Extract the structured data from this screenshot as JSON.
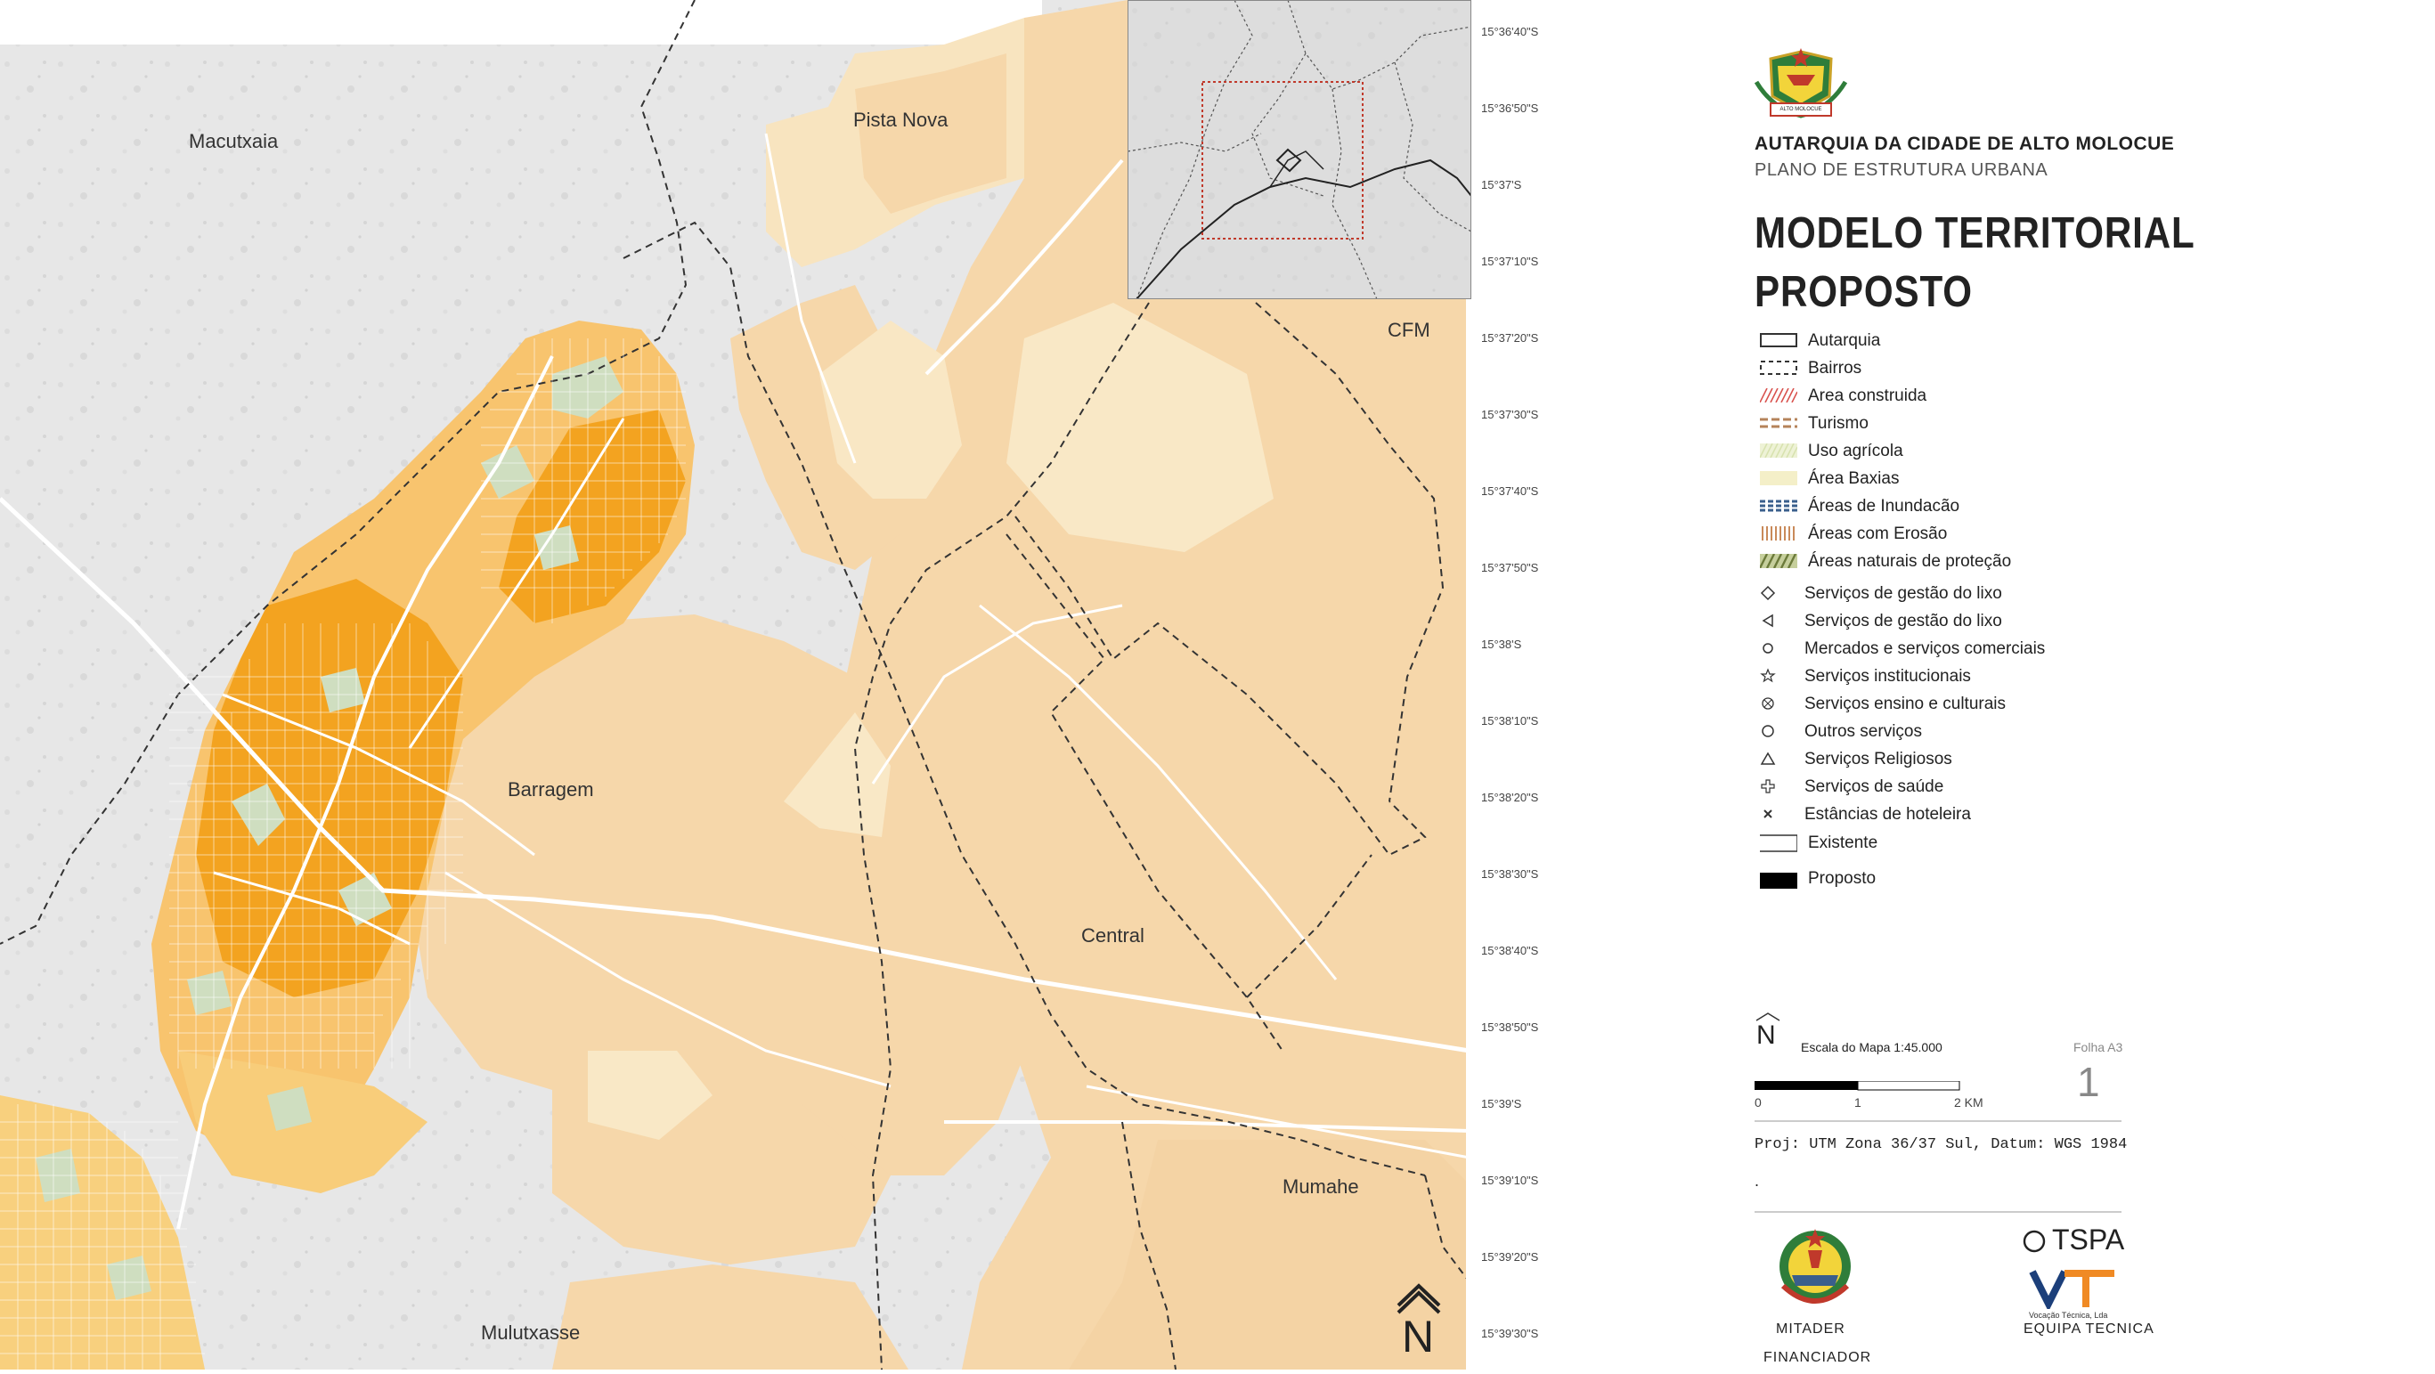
{
  "map": {
    "places": [
      {
        "name": "Macutxaia"
      },
      {
        "name": "Pista Nova"
      },
      {
        "name": "CFM"
      },
      {
        "name": "Barragem"
      },
      {
        "name": "Central"
      },
      {
        "name": "Mumahe"
      },
      {
        "name": "Mulutxasse"
      }
    ],
    "latitude_ticks": [
      "15°36'40\"S",
      "15°36'50\"S",
      "15°37'S",
      "15°37'10\"S",
      "15°37'20\"S",
      "15°37'30\"S",
      "15°37'40\"S",
      "15°37'50\"S",
      "15°38'S",
      "15°38'10\"S",
      "15°38'20\"S",
      "15°38'30\"S",
      "15°38'40\"S",
      "15°38'50\"S",
      "15°39'S",
      "15°39'10\"S",
      "15°39'20\"S",
      "15°39'30\"S"
    ],
    "north_arrow_label": "N",
    "colors": {
      "background_gray": "#e6e6e6",
      "land_orange": "#f7d8ab",
      "light_zone": "#f8e6c2",
      "dense_orange": "#f4a01e",
      "medium_orange": "#f8c46e",
      "green_plot": "#cfdec0",
      "road": "#ffffff",
      "boundary": "#333333"
    }
  },
  "panel": {
    "authority": "AUTARQUIA DA CIDADE DE ALTO MOLOCUE",
    "plan": "PLANO DE ESTRUTURA URBANA",
    "title_line1": "MODELO TERRITORIAL",
    "title_line2": "PROPOSTO",
    "emblem_caption": "ALTO MOLOCUE",
    "legend": [
      {
        "label": "Autarquia",
        "icon": "solid-outline-rect"
      },
      {
        "label": "Bairros",
        "icon": "dashed-outline-rect"
      },
      {
        "label": "Area construida",
        "icon": "red-hatch",
        "color": "#d9534f"
      },
      {
        "label": "Turismo",
        "icon": "brown-dashes",
        "color": "#b5835a"
      },
      {
        "label": "Uso agrícola",
        "icon": "light-green-hatch",
        "color": "#d8e2b0"
      },
      {
        "label": "Área Baxias",
        "icon": "pale-yellow-fill",
        "color": "#f4efc8"
      },
      {
        "label": "Áreas de Inundacão",
        "icon": "blue-dashes",
        "color": "#3a5f8c"
      },
      {
        "label": "Áreas com Erosão",
        "icon": "orange-vertical-hatch",
        "color": "#c98a5a"
      },
      {
        "label": "Áreas naturais de proteção",
        "icon": "olive-hatch",
        "color": "#6b7a3a"
      },
      {
        "label": "Serviços de gestão do lixo",
        "icon": "diamond-icon"
      },
      {
        "label": "Serviços de gestão do lixo",
        "icon": "triangle-left-icon"
      },
      {
        "label": "Mercados e serviços comerciais",
        "icon": "small-circle-icon"
      },
      {
        "label": "Serviços institucionais",
        "icon": "star-icon"
      },
      {
        "label": "Serviços ensino e culturais",
        "icon": "crossed-circle-icon"
      },
      {
        "label": "Outros serviços",
        "icon": "circle-icon"
      },
      {
        "label": "Serviços Religiosos",
        "icon": "triangle-up-icon"
      },
      {
        "label": "Serviços de saúde",
        "icon": "plus-icon"
      },
      {
        "label": "Estâncias de hoteleira",
        "icon": "x-icon"
      },
      {
        "label": "Existente",
        "icon": "open-rect-icon"
      },
      {
        "label": "Proposto",
        "icon": "filled-rect-icon"
      }
    ],
    "scale_text": "Escala do Mapa 1:45.000",
    "north_label": "N",
    "sheet_label": "Folha A3",
    "sheet_number": "1",
    "scale_ticks": [
      "0",
      "1",
      "2 KM"
    ],
    "projection": "Proj: UTM Zona 36/37 Sul, Datum: WGS 1984",
    "dot": ".",
    "tspa_logo": "TSPA",
    "vt_caption": "Vocação Técnica, Lda",
    "mitader_label": "MITADER",
    "financiador_label": "FINANCIADOR",
    "equipa_label": "EQUIPA TECNICA"
  }
}
